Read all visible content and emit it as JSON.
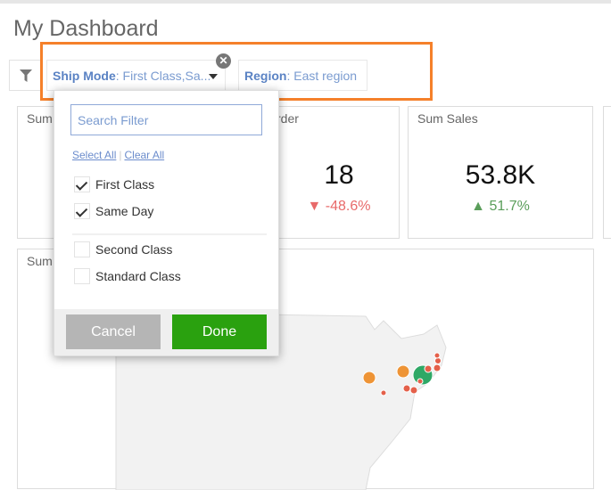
{
  "title": "My Dashboard",
  "filters": [
    {
      "field": "Ship Mode",
      "value": ": First Class,Sa..."
    },
    {
      "field": "Region",
      "value": ": East region"
    }
  ],
  "cards": [
    {
      "label": "Sum"
    },
    {
      "label": "rder",
      "value": "18",
      "delta": "-48.6%",
      "trend": "down"
    },
    {
      "label": "Sum Sales",
      "value": "53.8K",
      "delta": "51.7%",
      "trend": "up"
    }
  ],
  "map_card": {
    "label": "Sum"
  },
  "dropdown": {
    "search_placeholder": "Search Filter",
    "select_all": "Select All",
    "clear_all": "Clear All",
    "options": [
      {
        "label": "First Class",
        "checked": true
      },
      {
        "label": "Same Day",
        "checked": true
      },
      {
        "label": "Second Class",
        "checked": false
      },
      {
        "label": "Standard Class",
        "checked": false
      }
    ],
    "cancel": "Cancel",
    "done": "Done"
  },
  "colors": {
    "highlight": "#f5802a",
    "done": "#2aa10f",
    "cancel": "#b5b5b5",
    "up": "#5a9e5a",
    "down": "#e86a6a"
  }
}
